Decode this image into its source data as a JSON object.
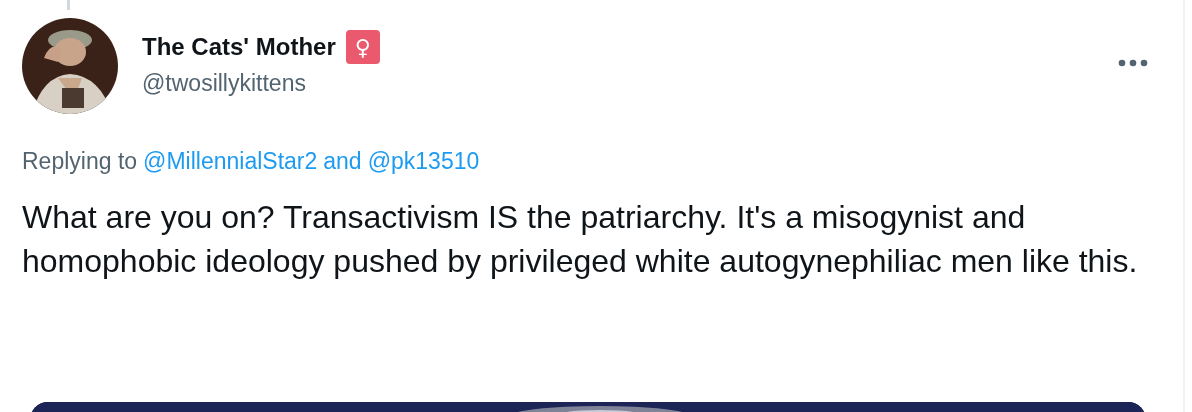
{
  "tweet": {
    "author": {
      "name": "The Cats' Mother",
      "badge": "♀",
      "handle": "@twosillykittens"
    },
    "reply_to": {
      "prefix": "Replying to",
      "first": "@MillennialStar2",
      "joiner": "and",
      "second": "@pk13510"
    },
    "text": "What are you on? Transactivism IS the patriarchy. It's a misogynist and homophobic ideology pushed by privileged white autogynephiliac men like this."
  }
}
